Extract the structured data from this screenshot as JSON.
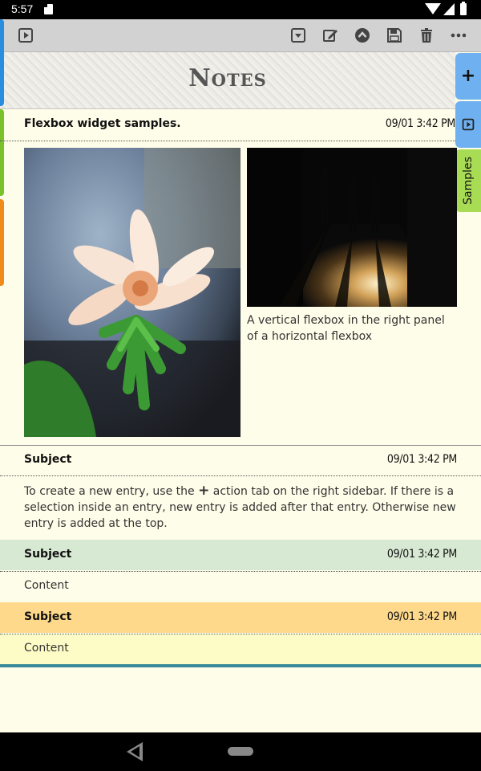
{
  "status_bar": {
    "time": "5:57"
  },
  "toolbar": {
    "left_icon": "play-icon",
    "right_icons": [
      "dropdown-icon",
      "edit-icon",
      "collapse-icon",
      "save-icon",
      "trash-icon",
      "more-icon"
    ]
  },
  "header": {
    "title": "Notes"
  },
  "sidebar": {
    "tabs": [
      {
        "icon": "plus-icon"
      },
      {
        "icon": "play-icon"
      },
      {
        "label": "Samples"
      }
    ]
  },
  "notes": [
    {
      "subject": "Flexbox widget samples.",
      "date": "09/01  3:42 PM",
      "caption": "A vertical flexbox in the right panel of a horizontal flexbox"
    },
    {
      "subject": "Subject",
      "date": "09/01  3:42 PM",
      "content_part1": "To create a new entry, use the",
      "content_part2": "action tab on the right sidebar. If there is a selection inside an entry, new entry is added after that entry. Otherwise new entry is added at the top."
    },
    {
      "subject": "Subject",
      "date": "09/01  3:42 PM",
      "content": "Content"
    },
    {
      "subject": "Subject",
      "date": "09/01  3:42 PM",
      "content": "Content"
    }
  ],
  "colors": {
    "toolbar": "#d2d2d2",
    "background": "#fefde9",
    "blue_tab": "#6fb1f0",
    "green_tab": "#a9dc55",
    "note3_header": "#d7e9d3",
    "note4_header": "#fed98c",
    "note4_body": "#fefcc6",
    "bottom_rule": "#3a8a9a",
    "stripe_blue": "#2a8ee0",
    "stripe_green": "#7ac22a",
    "stripe_orange": "#f08a1a"
  }
}
